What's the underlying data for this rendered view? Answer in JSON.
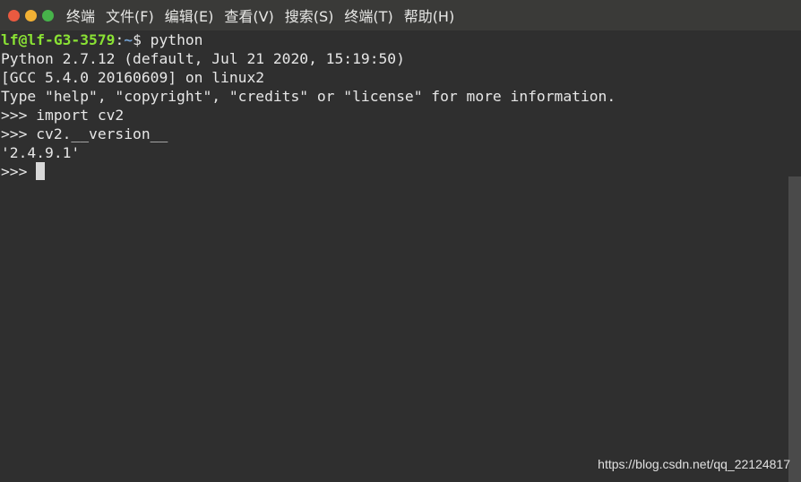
{
  "window": {
    "menu": [
      "终端",
      "文件(F)",
      "编辑(E)",
      "查看(V)",
      "搜索(S)",
      "终端(T)",
      "帮助(H)"
    ]
  },
  "terminal": {
    "prompt_user": "lf@lf-G3-3579",
    "prompt_sep": ":",
    "prompt_path": "~",
    "prompt_symbol": "$ ",
    "prompt_command": "python",
    "lines": [
      "Python 2.7.12 (default, Jul 21 2020, 15:19:50)",
      "[GCC 5.4.0 20160609] on linux2",
      "Type \"help\", \"copyright\", \"credits\" or \"license\" for more information.",
      ">>> import cv2",
      ">>> cv2.__version__",
      "'2.4.9.1'"
    ],
    "current_prompt": ">>> "
  },
  "watermark": "https://blog.csdn.net/qq_22124817",
  "colors": {
    "background": "#2f2f2f",
    "titlebar": "#3a3a38",
    "user": "#8ae234",
    "path": "#729fcf",
    "text": "#e6e6e6"
  }
}
